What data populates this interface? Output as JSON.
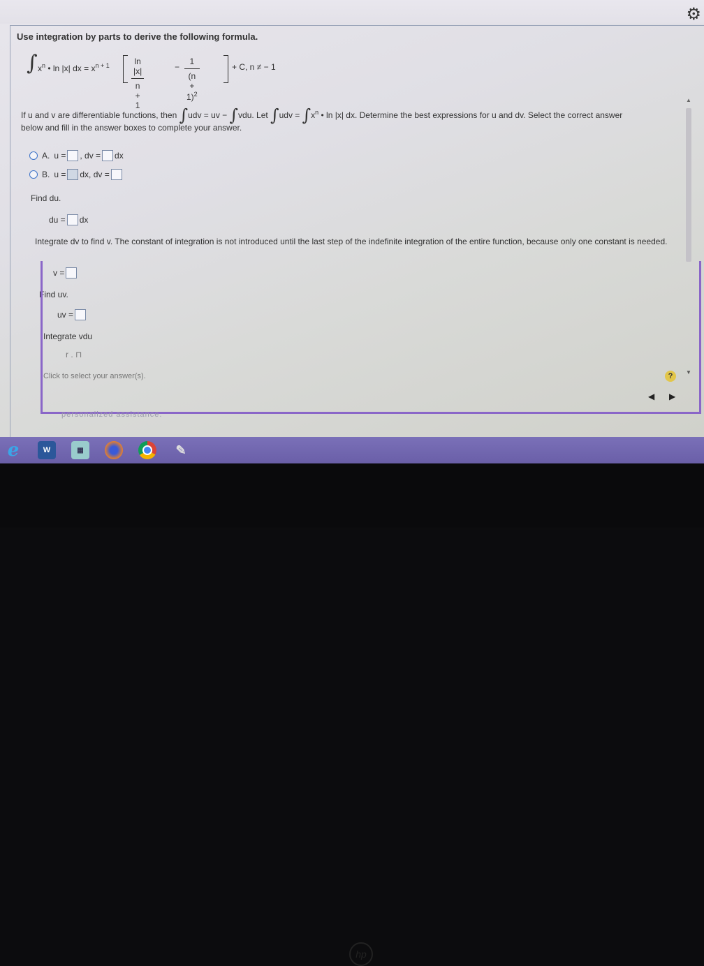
{
  "title": "Use integration by parts to derive the following formula.",
  "formula": {
    "integral": "∫",
    "left": "x",
    "left_exp": "n",
    "left_rest": " • ln |x| dx = x",
    "left_exp2": "n + 1",
    "frac1_num": "ln |x|",
    "frac1_den": "n + 1",
    "minus": "−",
    "frac2_num": "1",
    "frac2_den": "(n + 1)",
    "frac2_den_exp": "2",
    "right": "+ C, n ≠ − 1"
  },
  "intro": {
    "part1": "If u and v are differentiable functions, then",
    "part2": "udv = uv −",
    "part3": "vdu. Let",
    "part4": "udv =",
    "part5": "x",
    "part5_exp": "n",
    "part6": " • ln |x| dx. Determine the best expressions for u and dv. Select the correct answer",
    "part7": "below and fill in the answer boxes to complete your answer."
  },
  "options": {
    "a": {
      "label": "A.",
      "u": "u =",
      "dv": ", dv =",
      "dx": "dx"
    },
    "b": {
      "label": "B.",
      "u": "u =",
      "dx": "dx, dv ="
    }
  },
  "steps": {
    "find_du": "Find du.",
    "du_label": "du =",
    "du_dx": "dx",
    "integrate_dv": "Integrate dv to find v. The constant of integration is not introduced until the last step of the indefinite integration of the entire function, because only one constant is needed.",
    "v_label": "v =",
    "find_uv": "Find uv.",
    "uv_label": "uv =",
    "integrate_vdu": "Integrate vdu",
    "vdu_partial": "r . ⊓"
  },
  "footer": {
    "click_hint": "Click to select your answer(s).",
    "faded": "personalized assistance."
  },
  "ui": {
    "help": "?",
    "prev": "◀",
    "next": "▶",
    "gear": "⚙",
    "scroll_up": "▲",
    "scroll_down": "▼"
  },
  "taskbar": {
    "ie": "e",
    "word": "W",
    "grid": "▦"
  },
  "bezel": {
    "logo": "hp"
  }
}
